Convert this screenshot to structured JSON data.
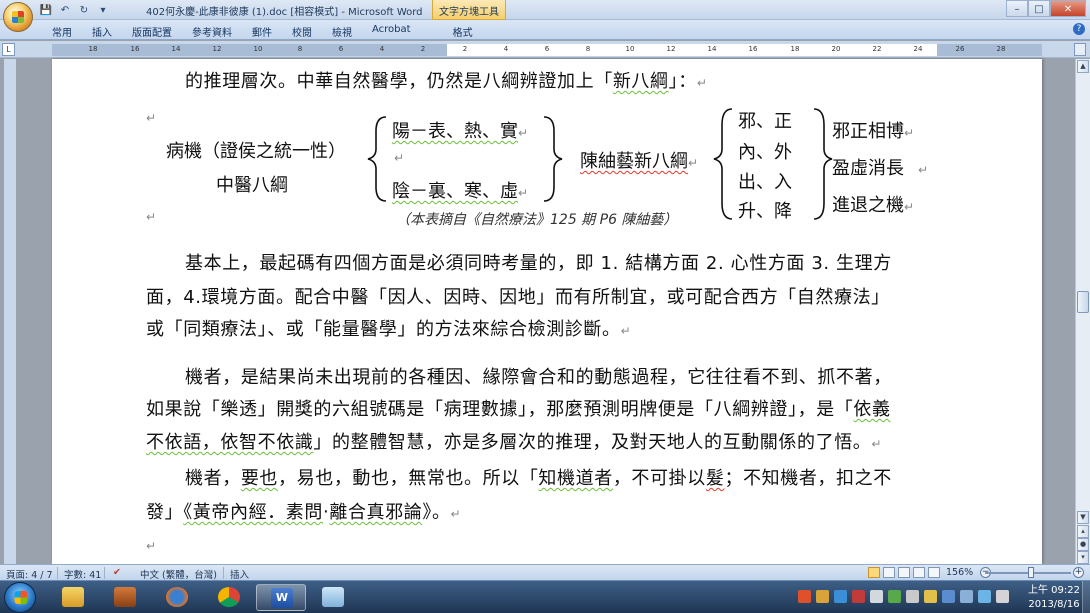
{
  "window": {
    "title": "402何永慶-此康非彼康 (1).doc [相容模式] - Microsoft Word",
    "tool_tab": "文字方塊工具",
    "minimize": "–",
    "maximize": "□",
    "close": "✕"
  },
  "qat": {
    "save": "💾",
    "undo": "↶",
    "redo": "↻",
    "customize": "▾"
  },
  "ribbon": {
    "tabs": [
      "常用",
      "插入",
      "版面配置",
      "參考資料",
      "郵件",
      "校閱",
      "檢視",
      "Acrobat"
    ],
    "tool_tab": "格式",
    "help": "?"
  },
  "ruler": {
    "corner": "L",
    "labels": [
      "18",
      "16",
      "14",
      "12",
      "10",
      "8",
      "6",
      "4",
      "2",
      "2",
      "4",
      "6",
      "8",
      "10",
      "12",
      "14",
      "16",
      "18",
      "20",
      "22",
      "24",
      "26",
      "28"
    ]
  },
  "document": {
    "line1": {
      "text_a": "的推理層次。中華自然醫學，仍然是八綱辨證加上「",
      "text_b": "新八綱",
      "text_c": "」：",
      "mark": "↵"
    },
    "diagram": {
      "left_top": "病機（證侯之統一性）",
      "left_bottom": "中醫八綱",
      "box1_top": "陽－表、熱、實",
      "box1_bottom": "陰－裏、寒、虛",
      "middle": "陳紬藝新八綱",
      "box2": [
        "邪、正",
        "內、外",
        "出、入",
        "升、降"
      ],
      "right": [
        "邪正相博",
        "盈虛消長",
        "進退之機"
      ],
      "caption": "（本表摘自《自然療法》125 期 P6 陳紬藝）"
    },
    "para1": {
      "line1": "基本上，最起碼有四個方面是必須同時考量的，即 1. 結構方面 2. 心性方面 3. 生理方",
      "line2": "面，4.環境方面。配合中醫「因人、因時、因地」而有所制宜，或可配合西方「自然療法」",
      "line3": "或「同類療法」、或「能量醫學」的方法來綜合檢測診斷。"
    },
    "para2": {
      "line1": "機者，是結果尚未出現前的各種因、緣際會合和的動態過程，它往往看不到、抓不著，",
      "line2_a": "如果說「樂透」開獎的六組號碼是「病理數據」，那麼預測明牌便是「八綱辨證」，是「",
      "line2_b": "依義",
      "line3_a": "不依語，依智不依識",
      "line3_b": "」的整體智慧，亦是多層次的推理，及對天地人的互動關係的了悟。"
    },
    "para3": {
      "line1_a": "機者，",
      "line1_b": "要也",
      "line1_c": "，易也，動也，無常也。所以「",
      "line1_d": "知機道者",
      "line1_e": "，不可掛以",
      "line1_f": "髮",
      "line1_g": "；不知機者，扣之不",
      "line2_a": "發」",
      "line2_b": "《黃帝內經．素問",
      "line2_c": "‧",
      "line2_d": "離合真邪論",
      "line2_e": "》。"
    }
  },
  "statusbar": {
    "page": "頁面: 4 / 7",
    "words": "字數: 41",
    "language": "中文 (繁體，台灣)",
    "mode": "插入",
    "zoom": "156%",
    "zoom_out": "−",
    "zoom_in": "+"
  },
  "taskbar": {
    "apps": [
      "explorer",
      "media",
      "firefox",
      "chrome",
      "word",
      "notepad"
    ],
    "word_label": "W",
    "time": "上午 09:22",
    "date": "2013/8/16"
  },
  "colors": {
    "ribbon": "#c4d6ee",
    "taskbar": "#1f3654",
    "page": "#ffffff"
  }
}
